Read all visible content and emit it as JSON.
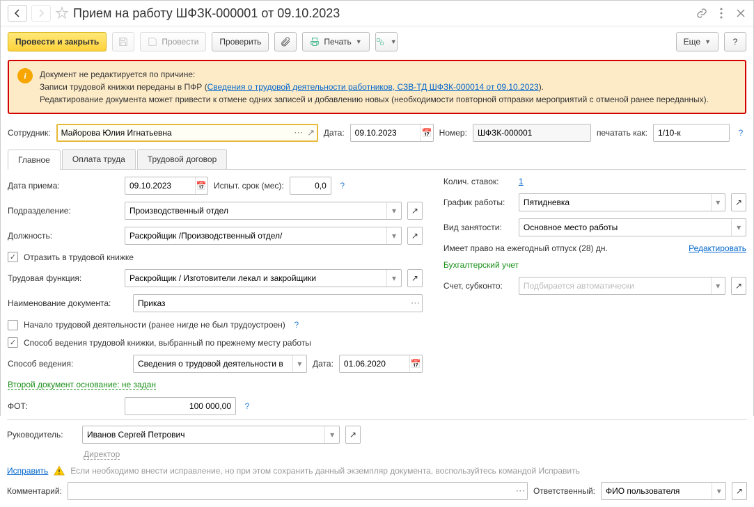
{
  "title": "Прием на работу ШФЗК-000001 от 09.10.2023",
  "toolbar": {
    "post_close": "Провести и закрыть",
    "post": "Провести",
    "check": "Проверить",
    "print": "Печать",
    "more": "Еще"
  },
  "alert": {
    "line1": "Документ не редактируется по причине:",
    "line2a": "Записи трудовой книжки переданы в ПФР (",
    "link": "Сведения о трудовой деятельности работников, СЗВ-ТД ШФЗК-000014 от 09.10.2023",
    "line2b": ").",
    "line3": "Редактирование документа может привести к отмене одних записей и добавлению новых (необходимости повторной отправки мероприятий с отменой ранее переданных)."
  },
  "header": {
    "employee_lbl": "Сотрудник:",
    "employee": "Майорова Юлия Игнатьевна",
    "date_lbl": "Дата:",
    "date": "09.10.2023",
    "number_lbl": "Номер:",
    "number": "ШФЗК-000001",
    "print_as_lbl": "печатать как:",
    "print_as": "1/10-к"
  },
  "tabs": [
    "Главное",
    "Оплата труда",
    "Трудовой договор"
  ],
  "main": {
    "hire_date_lbl": "Дата приема:",
    "hire_date": "09.10.2023",
    "probation_lbl": "Испыт. срок (мес):",
    "probation": "0,0",
    "dept_lbl": "Подразделение:",
    "dept": "Производственный отдел",
    "position_lbl": "Должность:",
    "position": "Раскройщик /Производственный отдел/",
    "reflect_lbl": "Отразить в трудовой книжке",
    "func_lbl": "Трудовая функция:",
    "func": "Раскройщик / Изготовители лекал и закройщики",
    "docname_lbl": "Наименование документа:",
    "docname": "Приказ",
    "first_job_lbl": "Начало трудовой деятельности (ранее нигде не был трудоустроен)",
    "prev_method_lbl": "Способ ведения трудовой книжки, выбранный по прежнему месту работы",
    "method_lbl": "Способ ведения:",
    "method": "Сведения о трудовой деятельности в",
    "method_date_lbl": "Дата:",
    "method_date": "01.06.2020",
    "second_doc": "Второй документ основание: не задан",
    "fot_lbl": "ФОТ:",
    "fot": "100 000,00",
    "rates_lbl": "Колич. ставок:",
    "rates": "1",
    "schedule_lbl": "График работы:",
    "schedule": "Пятидневка",
    "emp_type_lbl": "Вид занятости:",
    "emp_type": "Основное место работы",
    "vacation": "Имеет право на ежегодный отпуск (28) дн.",
    "edit_link": "Редактировать",
    "accounting": "Бухгалтерский учет",
    "account_lbl": "Счет, субконто:",
    "account_ph": "Подбирается автоматически"
  },
  "footer": {
    "head_lbl": "Руководитель:",
    "head": "Иванов Сергей Петрович",
    "head_pos": "Директор",
    "fix": "Исправить",
    "fix_text": "Если необходимо внести исправление, но при этом сохранить данный экземпляр документа, воспользуйтесь командой Исправить",
    "comment_lbl": "Комментарий:",
    "resp_lbl": "Ответственный:",
    "resp": "ФИО пользователя"
  }
}
